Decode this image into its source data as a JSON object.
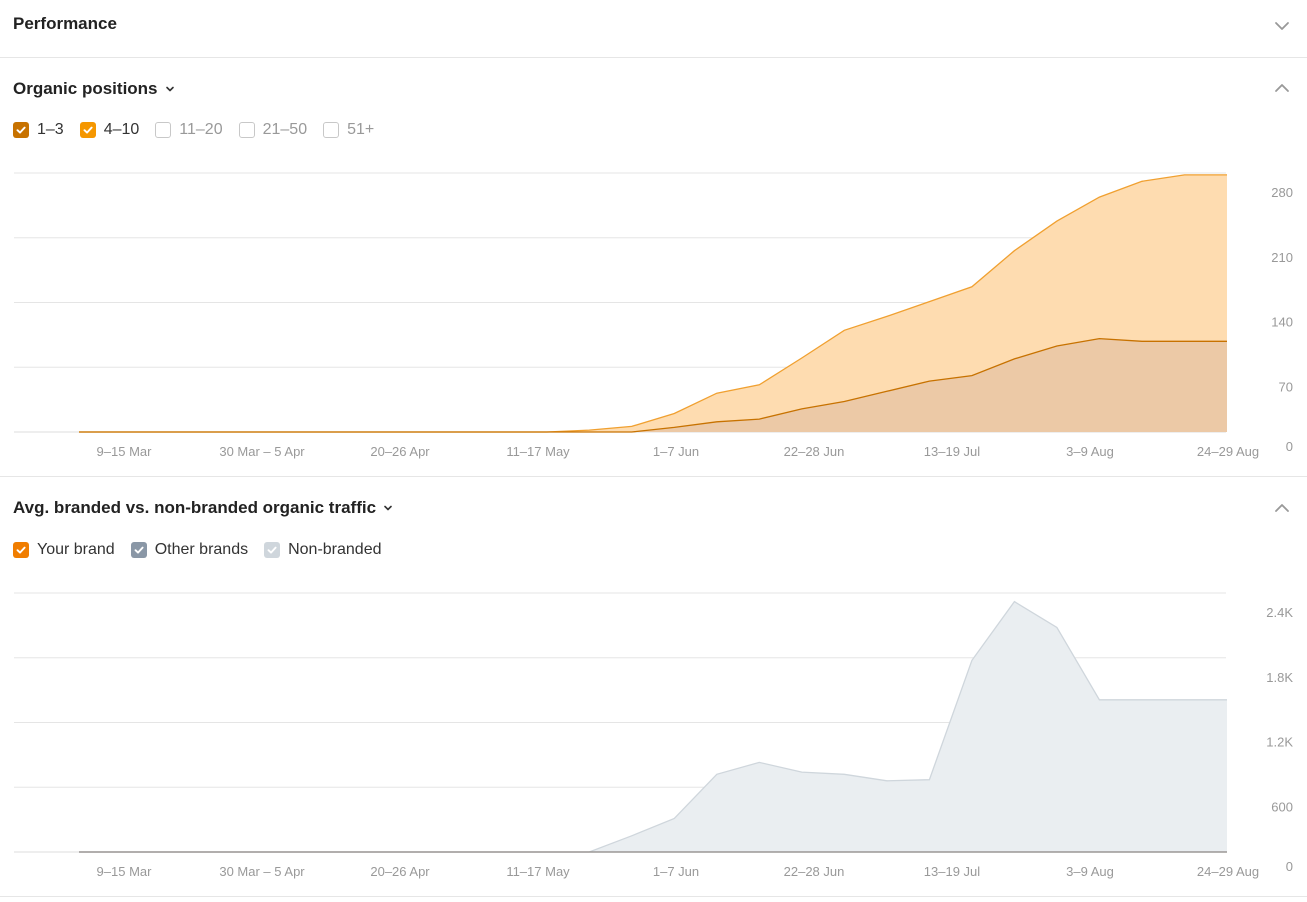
{
  "performance": {
    "title": "Performance"
  },
  "organic_positions": {
    "title": "Organic positions",
    "legend": [
      {
        "label": "1–3",
        "checked": true,
        "color": "#c77200"
      },
      {
        "label": "4–10",
        "checked": true,
        "color": "#f59700"
      },
      {
        "label": "11–20",
        "checked": false,
        "color": ""
      },
      {
        "label": "21–50",
        "checked": false,
        "color": ""
      },
      {
        "label": "51+",
        "checked": false,
        "color": ""
      }
    ]
  },
  "traffic": {
    "title": "Avg. branded vs. non-branded organic traffic",
    "legend": [
      {
        "label": "Your brand",
        "checked": true,
        "color": "#f07d00"
      },
      {
        "label": "Other brands",
        "checked": true,
        "color": "#8a97a6"
      },
      {
        "label": "Non-branded",
        "checked": true,
        "color": "#cfd6dc"
      }
    ]
  },
  "chart_data": [
    {
      "type": "area",
      "x_tick_labels": [
        "9–15 Mar",
        "30 Mar – 5 Apr",
        "20–26 Apr",
        "11–17 May",
        "1–7 Jun",
        "22–28 Jun",
        "13–19 Jul",
        "3–9 Aug",
        "24–29 Aug"
      ],
      "y_tick_labels": [
        "280",
        "210",
        "140",
        "70",
        "0"
      ],
      "y_ticks": [
        280,
        210,
        140,
        70,
        0
      ],
      "ylim": [
        0,
        280
      ],
      "grid": true,
      "series": [
        {
          "name": "4–10",
          "color": "#f0a030",
          "fill": "#fedcb0",
          "values": [
            0,
            0,
            0,
            0,
            0,
            0,
            0,
            0,
            0,
            0,
            0,
            0,
            2,
            6,
            20,
            42,
            51,
            80,
            110,
            125,
            141,
            157,
            196,
            228,
            254,
            271,
            278,
            278
          ]
        },
        {
          "name": "1–3",
          "color": "#c77200",
          "fill": "#ecc9a6",
          "values": [
            0,
            0,
            0,
            0,
            0,
            0,
            0,
            0,
            0,
            0,
            0,
            0,
            0,
            0,
            5,
            11,
            14,
            25,
            33,
            44,
            55,
            61,
            79,
            93,
            101,
            98,
            98,
            98
          ]
        }
      ]
    },
    {
      "type": "area",
      "x_tick_labels": [
        "9–15 Mar",
        "30 Mar – 5 Apr",
        "20–26 Apr",
        "11–17 May",
        "1–7 Jun",
        "22–28 Jun",
        "13–19 Jul",
        "3–9 Aug",
        "24–29 Aug"
      ],
      "y_tick_labels": [
        "2.4K",
        "1.8K",
        "1.2K",
        "600",
        "0"
      ],
      "y_ticks": [
        2400,
        1800,
        1200,
        600,
        0
      ],
      "ylim": [
        0,
        2400
      ],
      "grid": true,
      "series": [
        {
          "name": "Non-branded",
          "color": "#cfd6dc",
          "fill": "#eaeef1",
          "values": [
            0,
            0,
            0,
            0,
            0,
            0,
            0,
            0,
            0,
            0,
            0,
            0,
            0,
            150,
            310,
            720,
            830,
            740,
            720,
            660,
            670,
            1775,
            2320,
            2080,
            1410,
            1410,
            1410,
            1410
          ]
        },
        {
          "name": "Your brand",
          "color": "#f07d00",
          "fill": "none",
          "values": [
            0,
            0,
            0,
            0,
            0,
            0,
            0,
            0,
            0,
            0,
            0,
            0,
            0,
            0,
            0,
            0,
            0,
            0,
            0,
            0,
            0,
            0,
            0,
            0,
            0,
            0,
            0,
            0
          ]
        },
        {
          "name": "Other brands",
          "color": "#8a97a6",
          "fill": "none",
          "values": [
            0,
            0,
            0,
            0,
            0,
            0,
            0,
            0,
            0,
            0,
            0,
            0,
            0,
            0,
            0,
            0,
            0,
            0,
            0,
            0,
            0,
            0,
            0,
            0,
            0,
            0,
            0,
            0
          ]
        }
      ]
    }
  ]
}
